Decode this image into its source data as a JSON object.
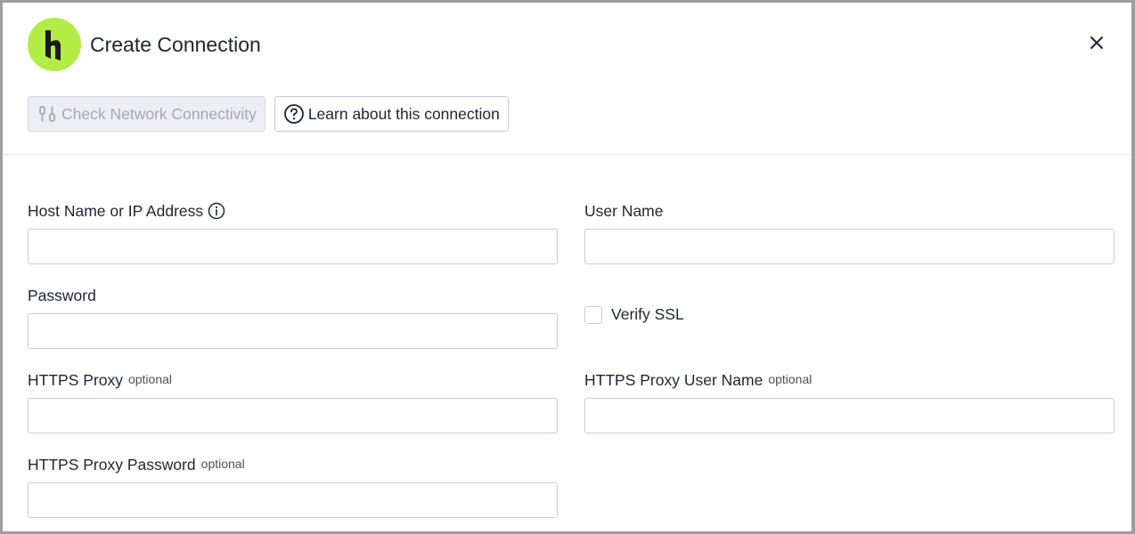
{
  "dialog": {
    "title": "Create Connection",
    "logo_color": "#b3ec47"
  },
  "toolbar": {
    "check_network_label": "Check Network Connectivity",
    "learn_label": "Learn about this connection"
  },
  "fields": {
    "host": {
      "label": "Host Name or IP Address",
      "value": "",
      "placeholder": ""
    },
    "username": {
      "label": "User Name",
      "value": "",
      "placeholder": ""
    },
    "password": {
      "label": "Password",
      "value": "",
      "placeholder": ""
    },
    "verify_ssl": {
      "label": "Verify SSL",
      "checked": false
    },
    "https_proxy": {
      "label": "HTTPS Proxy",
      "optional": "optional",
      "value": "",
      "placeholder": ""
    },
    "https_proxy_user": {
      "label": "HTTPS Proxy User Name",
      "optional": "optional",
      "value": "",
      "placeholder": ""
    },
    "https_proxy_password": {
      "label": "HTTPS Proxy Password",
      "optional": "optional",
      "value": "",
      "placeholder": ""
    }
  }
}
